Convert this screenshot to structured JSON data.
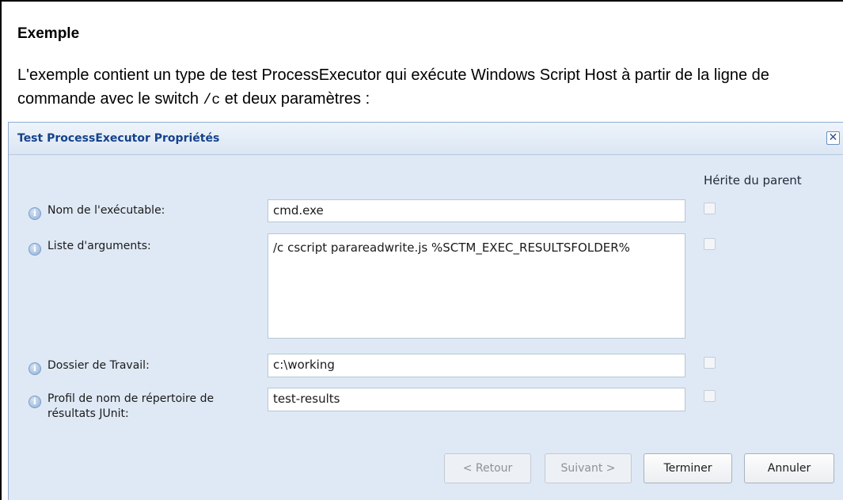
{
  "document": {
    "heading": "Exemple",
    "paragraph_before": "L'exemple contient un type de test ProcessExecutor qui exécute Windows Script Host à partir de la ligne de commande avec le switch ",
    "switch_code": "/c",
    "paragraph_after": " et deux paramètres :"
  },
  "dialog": {
    "title": "Test ProcessExecutor Propriétés",
    "close_glyph": "✕",
    "column_header": "Hérite du parent",
    "info_glyph": "i",
    "rows": [
      {
        "label": "Nom de l'exécutable:",
        "value": "cmd.exe",
        "inherit": false
      },
      {
        "label": "Liste d'arguments:",
        "value": "/c cscript parareadwrite.js %SCTM_EXEC_RESULTSFOLDER%",
        "inherit": false
      },
      {
        "label": "Dossier de Travail:",
        "value": "c:\\working",
        "inherit": false
      },
      {
        "label_line1": "Profil de nom de répertoire de",
        "label_line2": "résultats JUnit:",
        "value": "test-results",
        "inherit": false
      }
    ],
    "buttons": {
      "back": "< Retour",
      "next": "Suivant >",
      "finish": "Terminer",
      "cancel": "Annuler"
    }
  }
}
